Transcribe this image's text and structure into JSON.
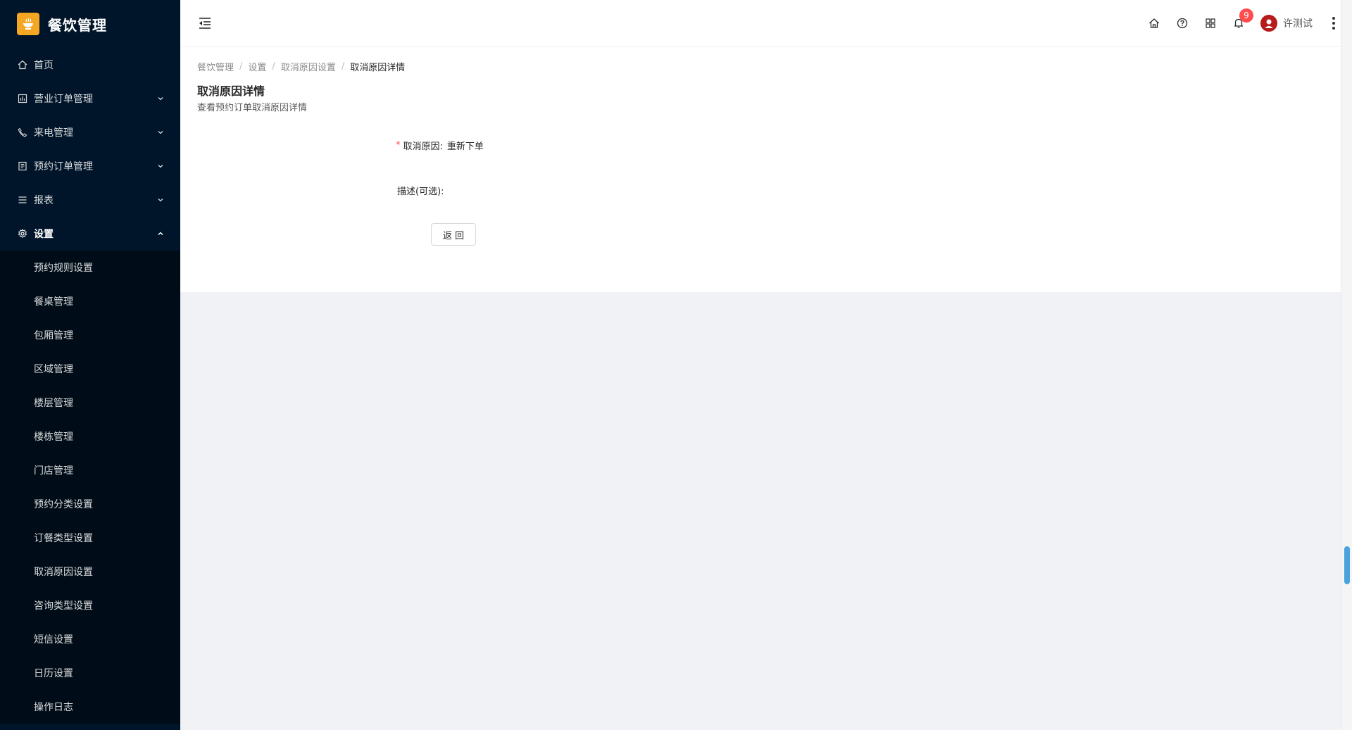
{
  "app": {
    "title": "餐饮管理",
    "accent": "#1890ff",
    "sidebar_bg": "#001529",
    "logo_color": "#f5a623"
  },
  "sidebar": {
    "items": [
      {
        "label": "首页",
        "icon": "home-icon",
        "expandable": false
      },
      {
        "label": "营业订单管理",
        "icon": "dashboard-icon",
        "expandable": true
      },
      {
        "label": "来电管理",
        "icon": "phone-icon",
        "expandable": true
      },
      {
        "label": "预约订单管理",
        "icon": "list-icon",
        "expandable": true
      },
      {
        "label": "报表",
        "icon": "menu-icon",
        "expandable": true
      },
      {
        "label": "设置",
        "icon": "gear-icon",
        "expandable": true,
        "expanded": true
      }
    ],
    "settings_submenu": [
      "预约规则设置",
      "餐桌管理",
      "包厢管理",
      "区域管理",
      "楼层管理",
      "楼栋管理",
      "门店管理",
      "预约分类设置",
      "订餐类型设置",
      "取消原因设置",
      "咨询类型设置",
      "短信设置",
      "日历设置",
      "操作日志"
    ]
  },
  "header": {
    "notifications_count": "9",
    "user_name": "许测试"
  },
  "breadcrumb": [
    "餐饮管理",
    "设置",
    "取消原因设置",
    "取消原因详情"
  ],
  "page": {
    "title": "取消原因详情",
    "description": "查看预约订单取消原因详情"
  },
  "form": {
    "reason_label": "取消原因:",
    "reason_value": "重新下单",
    "desc_label": "描述(可选):",
    "desc_value": "",
    "back_button": "返 回"
  }
}
